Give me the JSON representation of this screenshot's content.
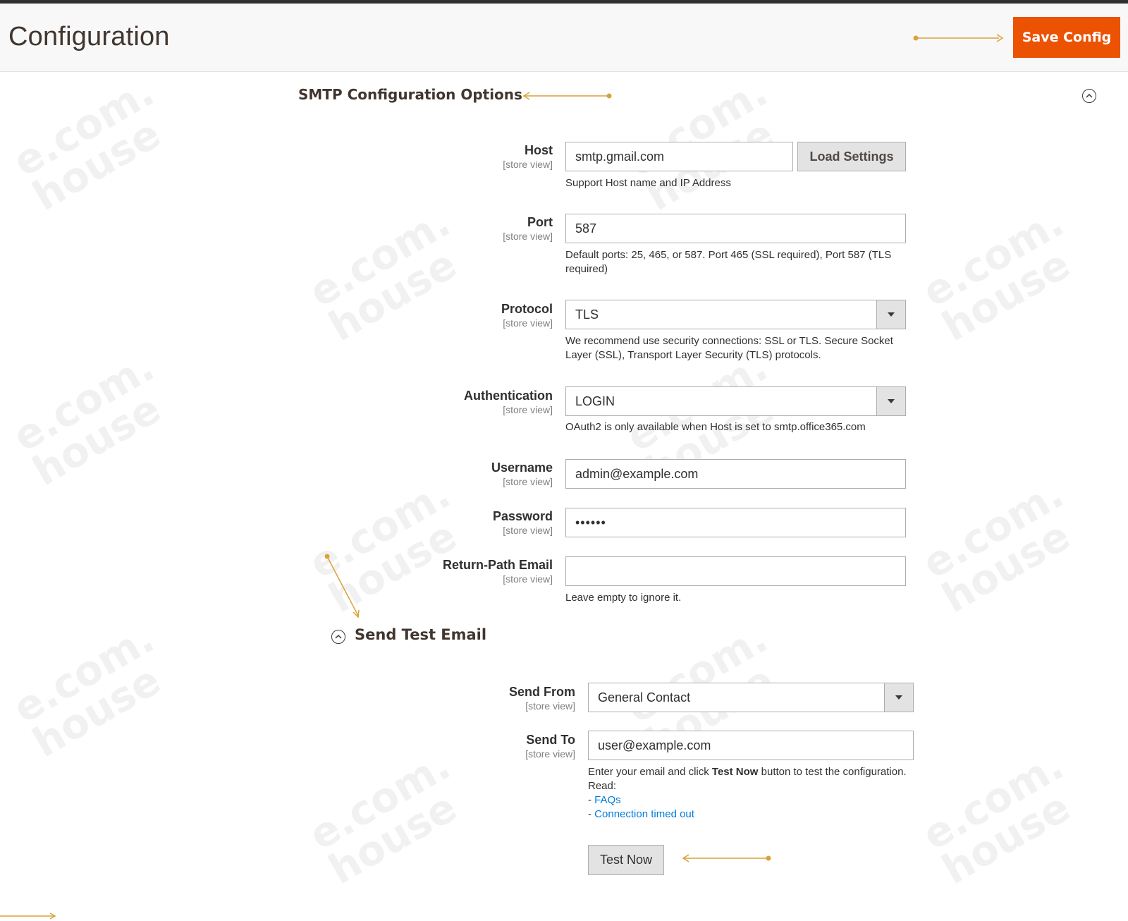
{
  "header": {
    "title": "Configuration",
    "save_label": "Save Config"
  },
  "section": {
    "title": "SMTP Configuration Options"
  },
  "fields": {
    "host": {
      "label": "Host",
      "scope": "[store view]",
      "value": "smtp.gmail.com",
      "button": "Load Settings",
      "note": "Support Host name and IP Address"
    },
    "port": {
      "label": "Port",
      "scope": "[store view]",
      "value": "587",
      "note": "Default ports: 25, 465, or 587. Port 465 (SSL required), Port 587 (TLS required)"
    },
    "protocol": {
      "label": "Protocol",
      "scope": "[store view]",
      "value": "TLS",
      "note": "We recommend use security connections: SSL or TLS. Secure Socket Layer (SSL), Transport Layer Security (TLS) protocols."
    },
    "authentication": {
      "label": "Authentication",
      "scope": "[store view]",
      "value": "LOGIN",
      "note": "OAuth2 is only available when Host is set to smtp.office365.com"
    },
    "username": {
      "label": "Username",
      "scope": "[store view]",
      "value": "admin@example.com"
    },
    "password": {
      "label": "Password",
      "scope": "[store view]",
      "value": "••••••"
    },
    "return_path": {
      "label": "Return-Path Email",
      "scope": "[store view]",
      "value": "",
      "note": "Leave empty to ignore it."
    }
  },
  "test_email": {
    "title": "Send Test Email",
    "send_from": {
      "label": "Send From",
      "scope": "[store view]",
      "value": "General Contact"
    },
    "send_to": {
      "label": "Send To",
      "scope": "[store view]",
      "value": "user@example.com"
    },
    "note_pre": "Enter your email and click ",
    "note_bold": "Test Now",
    "note_post": " button to test the configuration.",
    "note_read": "Read:",
    "link_prefix": "- ",
    "link_faqs": "FAQs",
    "link_timeout": "Connection timed out",
    "test_button": "Test Now"
  },
  "watermark_text": "e.com.\nhouse",
  "colors": {
    "accent": "#eb5202",
    "annotation": "#d9a23a",
    "link": "#007bdb"
  },
  "icons": {
    "collapse": "chevron-up-circle-icon",
    "dropdown": "caret-down-icon"
  }
}
